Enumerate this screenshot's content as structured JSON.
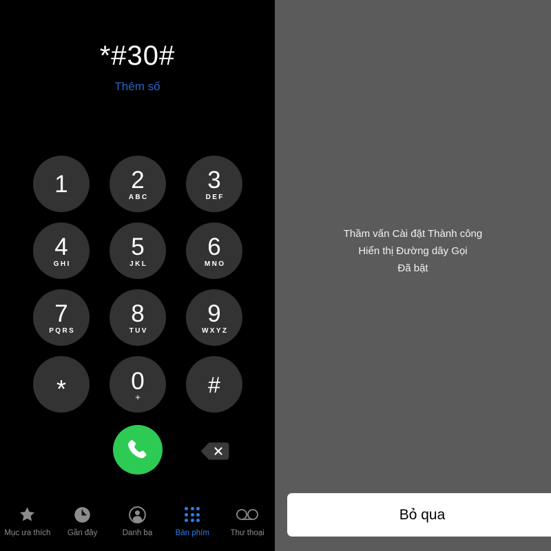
{
  "dialer": {
    "dialed_number": "*#30#",
    "add_number_label": "Thêm số",
    "accent_blue": "#2a64c8",
    "key_background": "#333333",
    "background": "#000000",
    "keys": [
      {
        "digit": "1",
        "letters": ""
      },
      {
        "digit": "2",
        "letters": "ABC"
      },
      {
        "digit": "3",
        "letters": "DEF"
      },
      {
        "digit": "4",
        "letters": "GHI"
      },
      {
        "digit": "5",
        "letters": "JKL"
      },
      {
        "digit": "6",
        "letters": "MNO"
      },
      {
        "digit": "7",
        "letters": "PQRS"
      },
      {
        "digit": "8",
        "letters": "TUV"
      },
      {
        "digit": "9",
        "letters": "WXYZ"
      },
      {
        "digit": "*",
        "letters": ""
      },
      {
        "digit": "0",
        "letters": "+"
      },
      {
        "digit": "#",
        "letters": ""
      }
    ],
    "call_button": {
      "icon": "phone-handset-icon",
      "color": "#2ecb54"
    },
    "delete_button": {
      "icon": "backspace-delete-icon",
      "color": "#3a3a3a"
    }
  },
  "tab_bar": {
    "active_color": "#2a7ef0",
    "inactive_color": "#8c8c8c",
    "items": [
      {
        "label": "Mục ưa thích",
        "icon": "star-icon",
        "active": false
      },
      {
        "label": "Gần đây",
        "icon": "clock-icon",
        "active": false
      },
      {
        "label": "Danh bạ",
        "icon": "person-circle-icon",
        "active": false
      },
      {
        "label": "Bàn phím",
        "icon": "keypad-grid-icon",
        "active": true
      },
      {
        "label": "Thư thoại",
        "icon": "voicemail-icon",
        "active": false
      }
    ]
  },
  "dialog": {
    "background": "#5b5b5b",
    "message_line_1": "Thầm vấn Cài đặt Thành công",
    "message_line_2": "Hiển thị Đường dây Gọi",
    "message_line_3": "Đã bật",
    "dismiss_label": "Bỏ qua"
  }
}
